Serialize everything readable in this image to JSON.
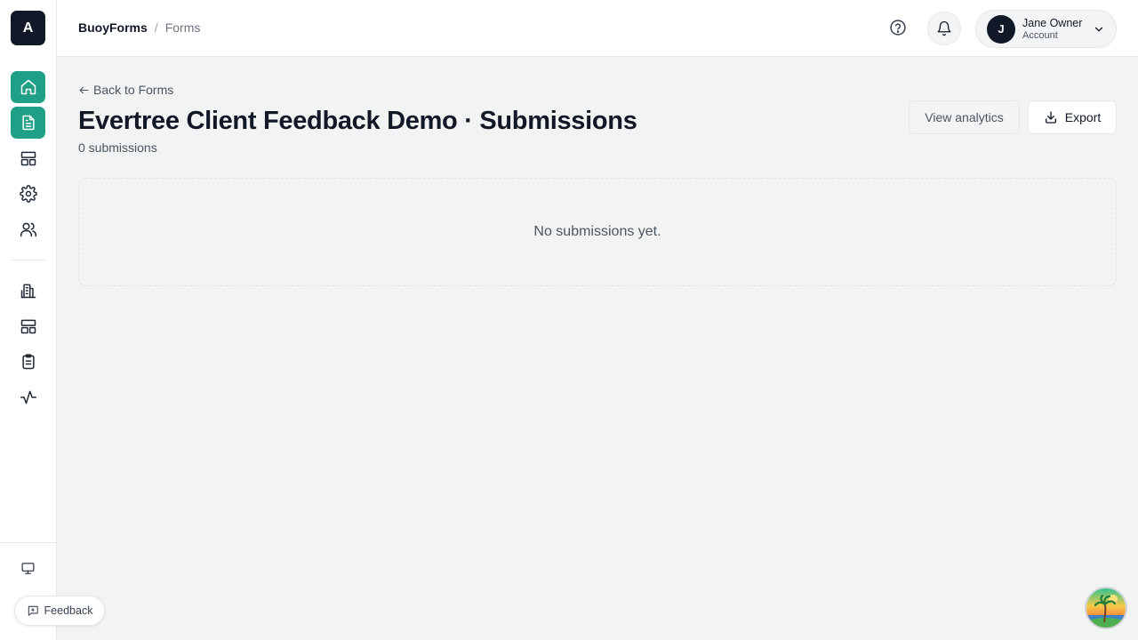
{
  "app": {
    "logo_letter": "A",
    "accent_color": "#1f9f86"
  },
  "sidebar": {
    "items": [
      {
        "icon": "home-icon",
        "active": true
      },
      {
        "icon": "document-icon",
        "active": true
      },
      {
        "icon": "layout-icon",
        "active": false
      },
      {
        "icon": "gear-icon",
        "active": false
      },
      {
        "icon": "users-icon",
        "active": false
      },
      {
        "icon": "building-icon",
        "active": false
      },
      {
        "icon": "layout-icon",
        "active": false
      },
      {
        "icon": "clipboard-icon",
        "active": false
      },
      {
        "icon": "activity-icon",
        "active": false
      },
      {
        "icon": "monitor-icon",
        "active": false
      }
    ]
  },
  "header": {
    "breadcrumb": {
      "root": "BuoyForms",
      "separator": "/",
      "current": "Forms"
    },
    "account": {
      "initial": "J",
      "name": "Jane Owner",
      "subtitle": "Account"
    }
  },
  "main": {
    "back_label": "Back to Forms",
    "title": "Evertree Client Feedback Demo · Submissions",
    "count_label": "0 submissions",
    "actions": {
      "analytics_label": "View analytics",
      "export_label": "Export"
    },
    "empty_message": "No submissions yet."
  },
  "footer": {
    "feedback_label": "Feedback"
  }
}
